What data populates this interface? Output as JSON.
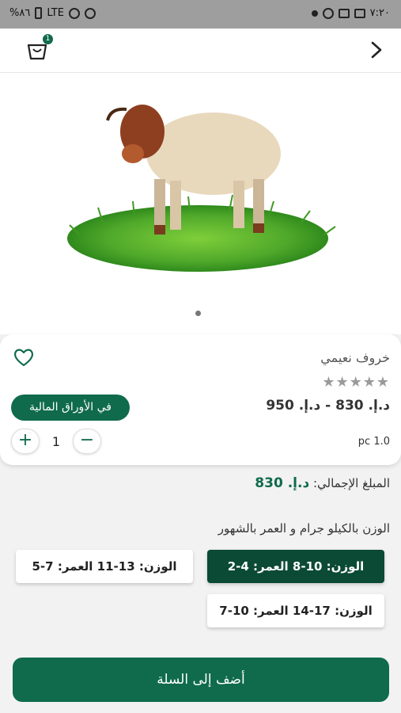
{
  "status_bar": {
    "time": "٧:٢٠",
    "battery": "%٨٦",
    "network": "LTE"
  },
  "header": {
    "cart_count": "1",
    "cart_icon": "shopping-bag-icon",
    "back_icon": "chevron-right-icon"
  },
  "product": {
    "title": "خروف نعيمي",
    "stars": "★★★★★",
    "price_range": "د.إ. 830 - د.إ. 950",
    "documents_button": "في الأوراق المالية",
    "unit": "pc 1.0",
    "quantity": "1",
    "minus": "−",
    "plus": "+"
  },
  "total": {
    "label": "المبلغ الإجمالي:",
    "amount": "د.إ. 830"
  },
  "weight_age": {
    "label": "الوزن بالكيلو جرام و العمر بالشهور",
    "options": [
      {
        "label": "الوزن: 10-8 العمر: 4-2",
        "selected": true
      },
      {
        "label": "الوزن: 13-11 العمر: 7-5",
        "selected": false
      },
      {
        "label": "الوزن: 17-14 العمر: 10-7",
        "selected": false
      }
    ]
  },
  "add_to_cart": "أضف إلى السلة",
  "colors": {
    "primary": "#0f6b4b",
    "selected": "#0b4a35"
  }
}
